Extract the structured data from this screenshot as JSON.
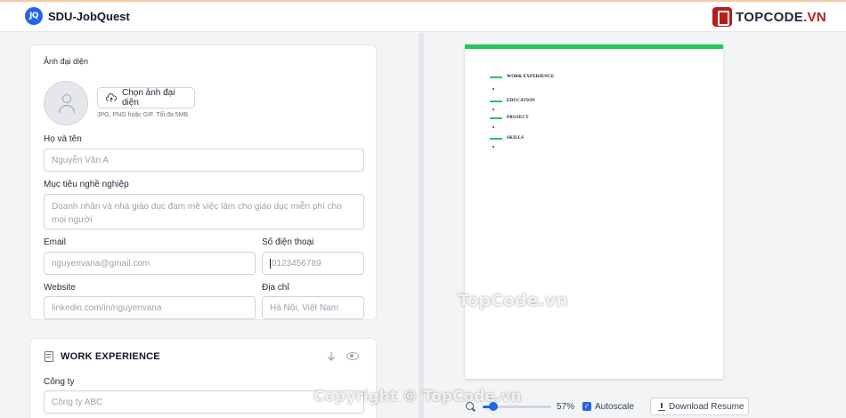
{
  "app": {
    "logo_text": "JQ",
    "name": "SDU-JobQuest"
  },
  "brand_badge": {
    "text": "TOPCODE",
    "suffix": ".VN"
  },
  "profile": {
    "avatar_label": "Ảnh đại diện",
    "upload_button": "Chọn ảnh đại diện",
    "upload_hint": "JPG, PNG hoặc GIF. Tối đa 5MB.",
    "fullname_label": "Họ và tên",
    "fullname_placeholder": "Nguyễn Văn A",
    "objective_label": "Mục tiêu nghề nghiệp",
    "objective_placeholder": "Doanh nhân và nhà giáo dục đam mê việc làm cho giáo dục miễn phí cho mọi người",
    "email_label": "Email",
    "email_placeholder": "nguyenvana@gmail.com",
    "phone_label": "Số điện thoại",
    "phone_placeholder": "0123456789",
    "website_label": "Website",
    "website_placeholder": "linkedin.com/in/nguyenvana",
    "address_label": "Địa chỉ",
    "address_placeholder": "Hà Nội, Việt Nam"
  },
  "work": {
    "title": "WORK EXPERIENCE",
    "company_label": "Công ty",
    "company_placeholder": "Công ty ABC"
  },
  "resume_preview": {
    "accent_color": "#22c55e",
    "sections": [
      "WORK EXPERIENCE",
      "EDUCATION",
      "PROJECT",
      "SKILLS"
    ]
  },
  "controls": {
    "zoom_value": "57%",
    "zoom_fraction": 0.15,
    "autoscale_label": "Autoscale",
    "autoscale_checked": true,
    "download_label": "Download Resume"
  },
  "watermarks": {
    "center": "TopCode.vn",
    "bottom": "Copyright © TopCode.vn"
  }
}
